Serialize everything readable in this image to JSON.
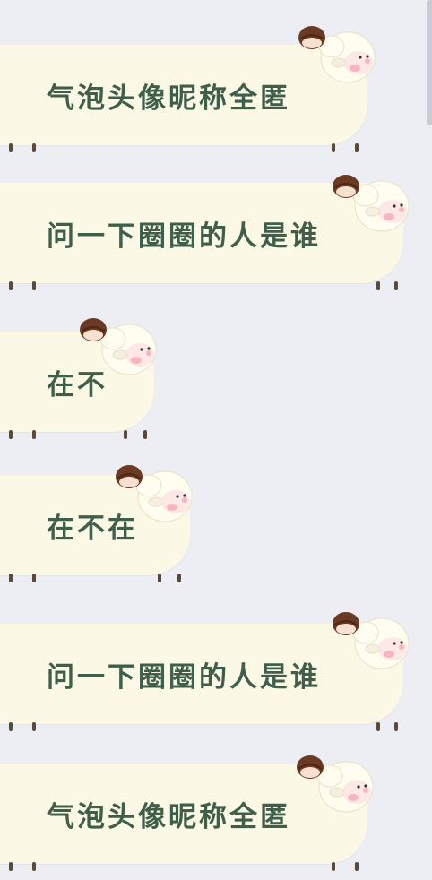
{
  "messages": [
    {
      "id": "m1",
      "text": "气泡头像昵称全匿"
    },
    {
      "id": "m2",
      "text": "问一下圈圈的人是谁"
    },
    {
      "id": "m3",
      "text": "在不"
    },
    {
      "id": "m4",
      "text": "在不在"
    },
    {
      "id": "m5",
      "text": "问一下圈圈的人是谁"
    },
    {
      "id": "m6",
      "text": "气泡头像昵称全匿"
    }
  ],
  "colors": {
    "background": "#eceef4",
    "bubble": "#fbf8e6",
    "text": "#3f5f4b",
    "hair": "#6b3a22",
    "cheek": "#f3a9b8"
  },
  "icons": {
    "bubble_decoration": "sheep-girl-icon"
  }
}
